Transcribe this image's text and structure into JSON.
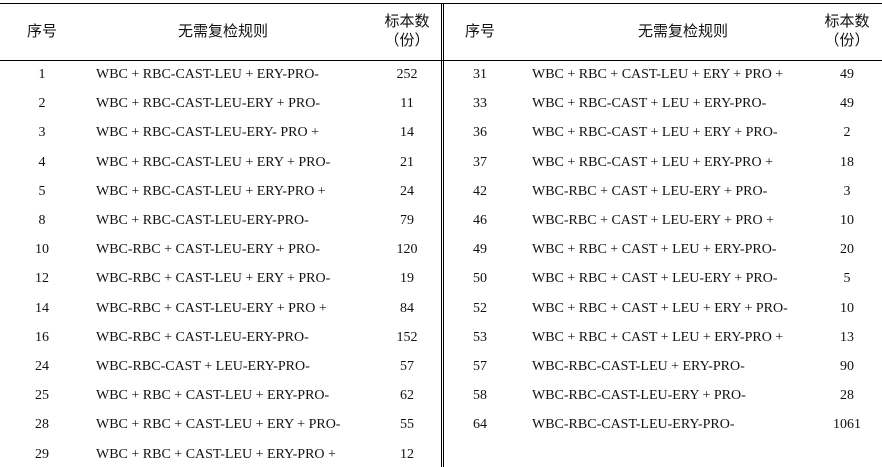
{
  "header": {
    "seq": "序号",
    "rule": "无需复检规则",
    "count_line1": "标本数",
    "count_line2": "（份）"
  },
  "left_rows": [
    {
      "seq": "1",
      "rule": "WBC + RBC-CAST-LEU + ERY-PRO-",
      "count": "252"
    },
    {
      "seq": "2",
      "rule": "WBC + RBC-CAST-LEU-ERY + PRO-",
      "count": "11"
    },
    {
      "seq": "3",
      "rule": "WBC + RBC-CAST-LEU-ERY- PRO +",
      "count": "14"
    },
    {
      "seq": "4",
      "rule": "WBC + RBC-CAST-LEU + ERY + PRO-",
      "count": "21"
    },
    {
      "seq": "5",
      "rule": "WBC + RBC-CAST-LEU + ERY-PRO +",
      "count": "24"
    },
    {
      "seq": "8",
      "rule": "WBC + RBC-CAST-LEU-ERY-PRO-",
      "count": "79"
    },
    {
      "seq": "10",
      "rule": "WBC-RBC + CAST-LEU-ERY + PRO-",
      "count": "120"
    },
    {
      "seq": "12",
      "rule": "WBC-RBC + CAST-LEU + ERY + PRO-",
      "count": "19"
    },
    {
      "seq": "14",
      "rule": "WBC-RBC + CAST-LEU-ERY + PRO +",
      "count": "84"
    },
    {
      "seq": "16",
      "rule": "WBC-RBC + CAST-LEU-ERY-PRO-",
      "count": "152"
    },
    {
      "seq": "24",
      "rule": "WBC-RBC-CAST + LEU-ERY-PRO-",
      "count": "57"
    },
    {
      "seq": "25",
      "rule": "WBC + RBC + CAST-LEU + ERY-PRO-",
      "count": "62"
    },
    {
      "seq": "28",
      "rule": "WBC + RBC + CAST-LEU + ERY + PRO-",
      "count": "55"
    },
    {
      "seq": "29",
      "rule": "WBC + RBC + CAST-LEU + ERY-PRO +",
      "count": "12"
    }
  ],
  "right_rows": [
    {
      "seq": "31",
      "rule": "WBC + RBC + CAST-LEU + ERY + PRO +",
      "count": "49"
    },
    {
      "seq": "33",
      "rule": "WBC + RBC-CAST + LEU + ERY-PRO-",
      "count": "49"
    },
    {
      "seq": "36",
      "rule": "WBC + RBC-CAST + LEU + ERY + PRO-",
      "count": "2"
    },
    {
      "seq": "37",
      "rule": "WBC + RBC-CAST + LEU + ERY-PRO +",
      "count": "18"
    },
    {
      "seq": "42",
      "rule": "WBC-RBC + CAST + LEU-ERY + PRO-",
      "count": "3"
    },
    {
      "seq": "46",
      "rule": "WBC-RBC + CAST + LEU-ERY + PRO +",
      "count": "10"
    },
    {
      "seq": "49",
      "rule": "WBC + RBC + CAST + LEU + ERY-PRO-",
      "count": "20"
    },
    {
      "seq": "50",
      "rule": "WBC + RBC + CAST + LEU-ERY + PRO-",
      "count": "5"
    },
    {
      "seq": "52",
      "rule": "WBC + RBC + CAST + LEU + ERY + PRO-",
      "count": "10"
    },
    {
      "seq": "53",
      "rule": "WBC + RBC + CAST + LEU + ERY-PRO +",
      "count": "13"
    },
    {
      "seq": "57",
      "rule": "WBC-RBC-CAST-LEU + ERY-PRO-",
      "count": "90"
    },
    {
      "seq": "58",
      "rule": "WBC-RBC-CAST-LEU-ERY + PRO-",
      "count": "28"
    },
    {
      "seq": "64",
      "rule": "WBC-RBC-CAST-LEU-ERY-PRO-",
      "count": "1061"
    }
  ]
}
